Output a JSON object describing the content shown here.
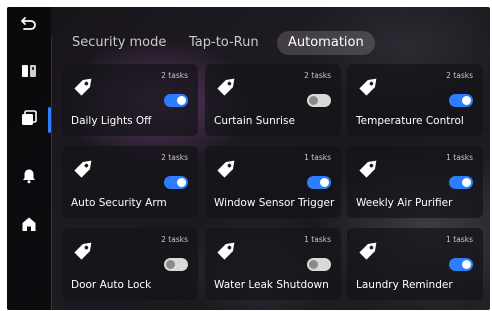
{
  "nav": {
    "back_icon": "back-arrow-icon",
    "items": [
      {
        "id": "devices",
        "icon": "devices-icon",
        "active": false
      },
      {
        "id": "scenes",
        "icon": "scenes-icon",
        "active": true
      },
      {
        "id": "alerts",
        "icon": "bell-icon",
        "active": false
      },
      {
        "id": "home",
        "icon": "home-icon",
        "active": false
      }
    ]
  },
  "tabs": [
    {
      "label": "Security mode",
      "active": false
    },
    {
      "label": "Tap-to-Run",
      "active": false
    },
    {
      "label": "Automation",
      "active": true
    }
  ],
  "automations": [
    {
      "name": "Daily Lights Off",
      "tasks": "2 tasks",
      "enabled": true
    },
    {
      "name": "Curtain Sunrise",
      "tasks": "2 tasks",
      "enabled": false
    },
    {
      "name": "Temperature Control",
      "tasks": "2 tasks",
      "enabled": true
    },
    {
      "name": "Auto Security Arm",
      "tasks": "2 tasks",
      "enabled": true
    },
    {
      "name": "Window Sensor Trigger",
      "tasks": "1 tasks",
      "enabled": true
    },
    {
      "name": "Weekly Air Purifier",
      "tasks": "1 tasks",
      "enabled": true
    },
    {
      "name": "Door Auto Lock",
      "tasks": "2 tasks",
      "enabled": false
    },
    {
      "name": "Water Leak Shutdown",
      "tasks": "1 tasks",
      "enabled": false
    },
    {
      "name": "Laundry Reminder",
      "tasks": "1 tasks",
      "enabled": true
    }
  ],
  "colors": {
    "accent": "#2d7dff",
    "toggle_off": "#d9d9d9"
  }
}
